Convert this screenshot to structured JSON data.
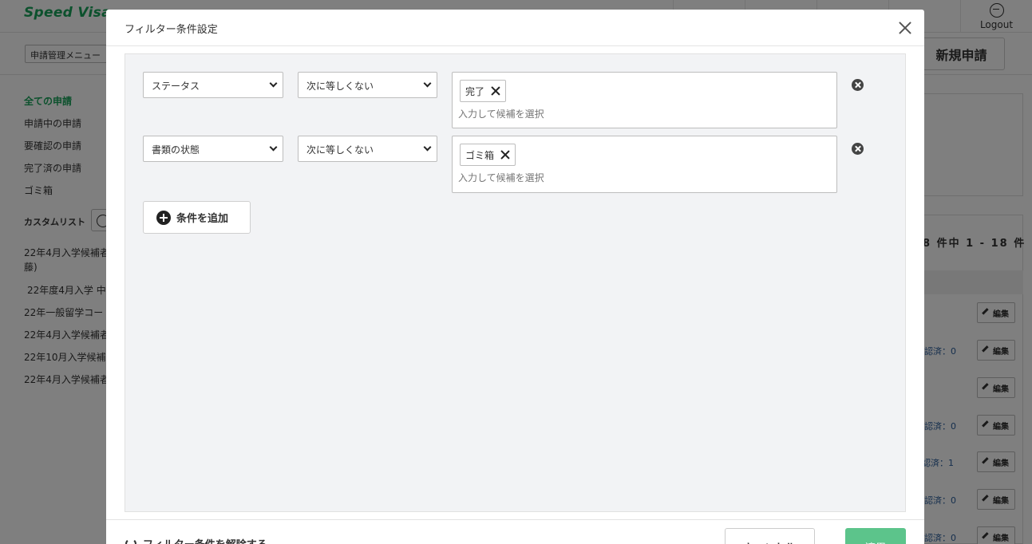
{
  "app": {
    "logo": "Speed Visa",
    "header_items": [
      "",
      "",
      "",
      ""
    ],
    "logout_label": "Logout",
    "menu_select": "申請管理メニュー",
    "new_application_label": "新規申請"
  },
  "sidebar": {
    "items": [
      {
        "label": "全ての申請",
        "active": true
      },
      {
        "label": "申請中の申請"
      },
      {
        "label": "要確認の申請"
      },
      {
        "label": "完了済の申請"
      },
      {
        "label": "ゴミ箱"
      }
    ],
    "custom_list_heading": "カスタムリスト",
    "custom_lists": [
      "22年4月入学候補者",
      "藤)",
      "22年度4月入学 中",
      "22年一般留学コー",
      "22年4月入学候補者",
      "22年10月入学候補",
      "22年4月入学候補者"
    ]
  },
  "list": {
    "count_text": "8 件中 1 - 18 件",
    "row_texts": [
      "認済：0",
      "認済：0",
      "認済：1",
      "認済：0",
      "認済：0"
    ],
    "edit_label": "編集"
  },
  "modal": {
    "title": "フィルター条件設定",
    "conditions": [
      {
        "field": "ステータス",
        "operator": "次に等しくない",
        "tag": "完了",
        "placeholder": "入力して候補を選択"
      },
      {
        "field": "書類の状態",
        "operator": "次に等しくない",
        "tag": "ゴミ箱",
        "placeholder": "入力して候補を選択"
      }
    ],
    "add_condition_label": "条件を追加",
    "clear_label": "フィルター条件を解除する",
    "cancel_label": "キャンセル",
    "apply_label": "適用"
  }
}
